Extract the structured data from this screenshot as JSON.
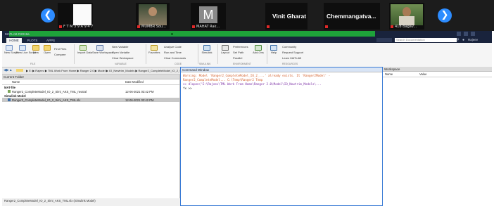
{
  "zoom": {
    "tiles": [
      {
        "name": "F T M 3 9 A 9 4 7"
      },
      {
        "name": "MUMBR Sou..."
      },
      {
        "name": "MAHAT Rak...",
        "initial": "M"
      },
      {
        "name": ""
      },
      {
        "name": ""
      },
      {
        "name": "418 Bagav..."
      }
    ],
    "participants_text": [
      "Vinit Gharat",
      "Chemmangatva..."
    ],
    "prev_icon": "chevron-left-icon",
    "next_icon": "chevron-right-icon",
    "accent": "#2d8cff"
  },
  "matlab": {
    "window_title": "MATLAB R2019a",
    "search_placeholder": "Search Documentation",
    "signin": "Rajeev",
    "tabs": [
      "HOME",
      "PLOTS",
      "APPS"
    ],
    "ribbon": {
      "file": [
        "New Script",
        "New Live Script",
        "New",
        "Open",
        "Find Files",
        "Compare"
      ],
      "variable": [
        "Import Data",
        "Save Workspace",
        "New Variable",
        "Open Variable",
        "Clear Workspace"
      ],
      "code": [
        "Favorites",
        "Analyze Code",
        "Run and Time",
        "Clear Commands"
      ],
      "simulink": [
        "Simulink"
      ],
      "environment": [
        "Layout",
        "Preferences",
        "Set Path",
        "Parallel"
      ],
      "addons": [
        "Add-Ons"
      ],
      "resources": [
        "Help",
        "Community",
        "Request Support",
        "Learn MATLAB"
      ],
      "section_labels": [
        "FILE",
        "VARIABLE",
        "CODE",
        "SIMULINK",
        "ENVIRONMENT",
        "RESOURCES"
      ]
    },
    "address": "▶ E: ▶ Rajeev ▶ TML Work From Home ▶ Ranger 2.0 ▶ Model ▶ IO_Newtrim_Models ▶ Ranger2_CompleteModel_IO_2_Simi_AKS_TML_VTS_TTB",
    "current_folder": {
      "title": "Current Folder",
      "columns": [
        "Name",
        "Date Modified"
      ],
      "groups": [
        {
          "label": "MAT-file",
          "files": [
            {
              "name": "Ranger2_CompleteModel_IO_2_Simi_AKS_TML_neutral",
              "date": "12-06-2021 03:42 PM"
            }
          ]
        },
        {
          "label": "Simulink Model",
          "files": [
            {
              "name": "Ranger2_CompleteModel_IO_2_Simi_AKS_TML.slx",
              "date": "12-06-2021 03:42 PM"
            }
          ]
        }
      ]
    },
    "command_window": {
      "title": "Command Window",
      "lines": [
        "Warning: Model 'Ranger2_CompleteModel_IO_2_...' already exists. It 'Ranger2Model' -",
        "Ranger2_CompleteModel... C:\\Temp\\Ranger2 Temp",
        ">> dlopen('E:\\Rajeev\\TML Work From Home\\Ranger 2.0\\Model\\IO_Newtrim_Models\\...",
        "fx >>"
      ]
    },
    "workspace": {
      "title": "Workspace",
      "columns": [
        "Name",
        "Value"
      ]
    },
    "status": "Ranger2_CompleteModel_IO_2_Simi_AKS_TML.slx (Simulink Model)"
  }
}
